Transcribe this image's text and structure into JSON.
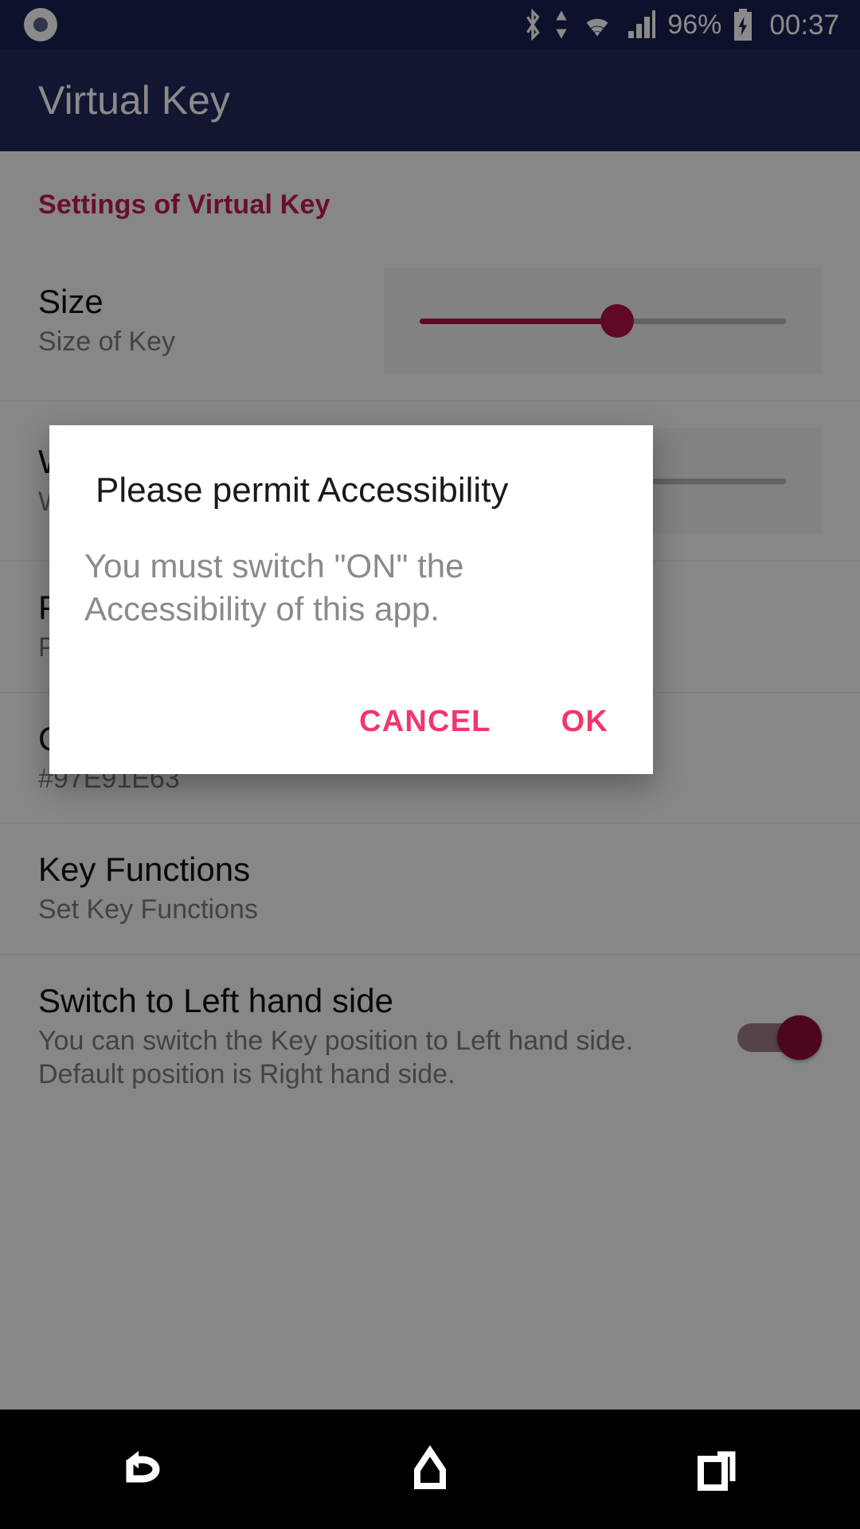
{
  "status_bar": {
    "notification_icon": "circle-dot-icon",
    "icons": [
      "bluetooth-icon",
      "data-transfer-icon",
      "wifi-icon",
      "cellular-signal-icon"
    ],
    "battery_percent": "96%",
    "battery_icon": "battery-charging-icon",
    "clock": "00:37"
  },
  "app_bar": {
    "title": "Virtual Key"
  },
  "settings": {
    "section_header": "Settings of Virtual Key",
    "rows": [
      {
        "title": "Size",
        "subtitle": "Size of Key",
        "widget": "slider",
        "slider_value_percent": 54
      },
      {
        "title": "W",
        "subtitle": "W",
        "widget": "none"
      },
      {
        "title": "P",
        "subtitle": "P",
        "widget": "none"
      },
      {
        "title": "C",
        "subtitle": "#97E91E63",
        "widget": "none"
      },
      {
        "title": "Key Functions",
        "subtitle": "Set Key Functions",
        "widget": "none"
      },
      {
        "title": "Switch to Left hand side",
        "subtitle": "You can switch the Key position to Left hand side.\nDefault position is Right hand side.",
        "widget": "switch",
        "switch_on": true
      }
    ]
  },
  "dialog": {
    "title": "Please permit Accessibility",
    "message": "You must switch \"ON\" the Accessibility of this app.",
    "cancel_label": "CANCEL",
    "ok_label": "OK"
  },
  "nav_bar": {
    "back": "back-icon",
    "home": "home-icon",
    "recents": "recents-icon"
  },
  "colors": {
    "accent": "#c2185b",
    "dialog_action": "#f0376d",
    "app_bar": "#232a5c",
    "status_bar": "#1b2150",
    "slider_active": "#b1104a",
    "switch_thumb": "#8e0c3e"
  }
}
